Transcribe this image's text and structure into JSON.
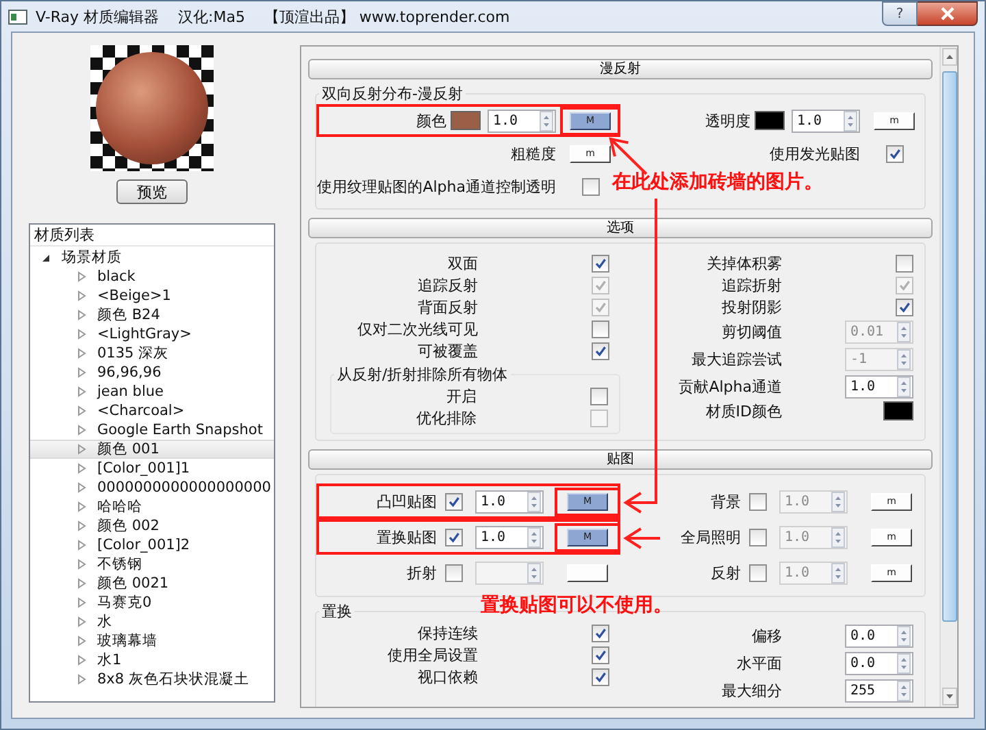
{
  "window": {
    "title": [
      "V-Ray 材质编辑器",
      "汉化:Ma5",
      "【顶渲出品】 www.toprender.com"
    ],
    "help": "?"
  },
  "preview": {
    "button": "预览"
  },
  "material_list": {
    "title": "材质列表",
    "root": {
      "label": "场景材质",
      "expanded": true,
      "children": [
        {
          "label": "black",
          "expanded": false,
          "selected": false
        },
        {
          "label": "<Beige>1",
          "expanded": false,
          "selected": false
        },
        {
          "label": "颜色 B24",
          "expanded": false,
          "selected": false
        },
        {
          "label": "<LightGray>",
          "expanded": false,
          "selected": false
        },
        {
          "label": "0135 深灰",
          "expanded": false,
          "selected": false
        },
        {
          "label": "96,96,96",
          "expanded": false,
          "selected": false
        },
        {
          "label": "jean blue",
          "expanded": false,
          "selected": false
        },
        {
          "label": "<Charcoal>",
          "expanded": false,
          "selected": false
        },
        {
          "label": "Google Earth Snapshot",
          "expanded": false,
          "selected": false
        },
        {
          "label": "颜色 001",
          "expanded": false,
          "selected": true
        },
        {
          "label": "[Color_001]1",
          "expanded": false,
          "selected": false
        },
        {
          "label": "0000000000000000000",
          "expanded": false,
          "selected": false
        },
        {
          "label": "哈哈哈",
          "expanded": false,
          "selected": false
        },
        {
          "label": "颜色 002",
          "expanded": false,
          "selected": false
        },
        {
          "label": "[Color_001]2",
          "expanded": false,
          "selected": false
        },
        {
          "label": "不锈钢",
          "expanded": false,
          "selected": false
        },
        {
          "label": "颜色 0021",
          "expanded": false,
          "selected": false
        },
        {
          "label": "马赛克0",
          "expanded": false,
          "selected": false
        },
        {
          "label": "水",
          "expanded": false,
          "selected": false
        },
        {
          "label": "玻璃幕墙",
          "expanded": false,
          "selected": false
        },
        {
          "label": "水1",
          "expanded": false,
          "selected": false
        },
        {
          "label": "8x8 灰色石块状混凝土",
          "expanded": false,
          "selected": false
        }
      ]
    }
  },
  "sections": [
    {
      "header": "漫反射",
      "groups": [
        {
          "kind": "diffuse",
          "title": "双向反射分布-漫反射",
          "columns": [
            [
              {
                "kind": "field",
                "label": "颜色",
                "highlighted": true,
                "controls": [
                  {
                    "kind": "swatch",
                    "color": "#9b5f48"
                  },
                  {
                    "kind": "spin",
                    "value": "1.0",
                    "disabled": false
                  },
                  {
                    "kind": "map",
                    "text": "M",
                    "assigned": true,
                    "highlighted": true
                  }
                ]
              },
              {
                "kind": "field",
                "label": "粗糙度",
                "highlighted": false,
                "controls": [
                  {
                    "kind": "map",
                    "text": "m",
                    "assigned": false,
                    "highlighted": false
                  }
                ]
              },
              {
                "kind": "field",
                "label": "使用纹理贴图的Alpha通道控制透明",
                "highlighted": false,
                "controls": [
                  {
                    "kind": "check",
                    "checked": false,
                    "disabled": false
                  }
                ]
              }
            ],
            [
              {
                "kind": "field",
                "label": "透明度",
                "highlighted": false,
                "controls": [
                  {
                    "kind": "swatch",
                    "color": "#000000"
                  },
                  {
                    "kind": "spin",
                    "value": "1.0",
                    "disabled": false
                  },
                  {
                    "kind": "map",
                    "text": "m",
                    "assigned": false,
                    "highlighted": false
                  }
                ]
              },
              {
                "kind": "field",
                "label": "使用发光贴图",
                "highlighted": false,
                "controls": [
                  {
                    "kind": "check",
                    "checked": true,
                    "disabled": false
                  }
                ]
              }
            ]
          ]
        }
      ]
    },
    {
      "header": "选项",
      "groups": [
        {
          "kind": "opts",
          "columns": [
            [
              {
                "kind": "field",
                "label": "双面",
                "controls": [
                  {
                    "kind": "check",
                    "checked": true,
                    "disabled": false
                  }
                ]
              },
              {
                "kind": "field",
                "label": "追踪反射",
                "controls": [
                  {
                    "kind": "check",
                    "checked": true,
                    "disabled": true
                  }
                ]
              },
              {
                "kind": "field",
                "label": "背面反射",
                "controls": [
                  {
                    "kind": "check",
                    "checked": true,
                    "disabled": true
                  }
                ]
              },
              {
                "kind": "field",
                "label": "仅对二次光线可见",
                "controls": [
                  {
                    "kind": "check",
                    "checked": false,
                    "disabled": false
                  }
                ]
              },
              {
                "kind": "field",
                "label": "可被覆盖",
                "controls": [
                  {
                    "kind": "check",
                    "checked": true,
                    "disabled": false
                  }
                ]
              },
              {
                "kind": "subgroup",
                "title": "从反射/折射排除所有物体",
                "fields": [
                  {
                    "kind": "field",
                    "label": "开启",
                    "controls": [
                      {
                        "kind": "check",
                        "checked": false,
                        "disabled": false
                      }
                    ]
                  },
                  {
                    "kind": "field",
                    "label": "优化排除",
                    "controls": [
                      {
                        "kind": "check",
                        "checked": false,
                        "disabled": true
                      }
                    ]
                  }
                ]
              }
            ],
            [
              {
                "kind": "field",
                "label": "关掉体积雾",
                "controls": [
                  {
                    "kind": "check",
                    "checked": false,
                    "disabled": false
                  }
                ]
              },
              {
                "kind": "field",
                "label": "追踪折射",
                "controls": [
                  {
                    "kind": "check",
                    "checked": true,
                    "disabled": true
                  }
                ]
              },
              {
                "kind": "field",
                "label": "投射阴影",
                "controls": [
                  {
                    "kind": "check",
                    "checked": true,
                    "disabled": false
                  }
                ]
              },
              {
                "kind": "field",
                "label": "剪切阈值",
                "controls": [
                  {
                    "kind": "spin",
                    "value": "0.01",
                    "disabled": true
                  }
                ]
              },
              {
                "kind": "field",
                "label": "最大追踪尝试",
                "controls": [
                  {
                    "kind": "spin",
                    "value": "-1",
                    "disabled": true
                  }
                ]
              },
              {
                "kind": "field",
                "label": "贡献Alpha通道",
                "controls": [
                  {
                    "kind": "spin",
                    "value": "1.0",
                    "disabled": false
                  }
                ]
              },
              {
                "kind": "field",
                "label": "材质ID颜色",
                "controls": [
                  {
                    "kind": "swatch",
                    "color": "#000000"
                  }
                ]
              }
            ]
          ]
        }
      ]
    },
    {
      "header": "贴图",
      "groups": [
        {
          "kind": "maps",
          "columns": [
            [
              {
                "kind": "field",
                "label": "凸凹贴图",
                "highlighted": true,
                "controls": [
                  {
                    "kind": "check",
                    "checked": true,
                    "disabled": false
                  },
                  {
                    "kind": "spin",
                    "value": "1.0",
                    "disabled": false
                  },
                  {
                    "kind": "map",
                    "text": "M",
                    "assigned": true,
                    "highlighted": true
                  }
                ]
              },
              {
                "kind": "field",
                "label": "置换贴图",
                "highlighted": true,
                "controls": [
                  {
                    "kind": "check",
                    "checked": true,
                    "disabled": false
                  },
                  {
                    "kind": "spin",
                    "value": "1.0",
                    "disabled": false
                  },
                  {
                    "kind": "map",
                    "text": "M",
                    "assigned": true,
                    "highlighted": true
                  }
                ]
              },
              {
                "kind": "field",
                "label": "折射",
                "highlighted": false,
                "controls": [
                  {
                    "kind": "check",
                    "checked": false,
                    "disabled": false
                  },
                  {
                    "kind": "spin",
                    "disabled": true
                  },
                  {
                    "kind": "map",
                    "assigned": false,
                    "highlighted": false
                  }
                ]
              }
            ],
            [
              {
                "kind": "field",
                "label": "背景",
                "highlighted": false,
                "controls": [
                  {
                    "kind": "check",
                    "checked": false,
                    "disabled": false
                  },
                  {
                    "kind": "spin",
                    "value": "1.0",
                    "disabled": true
                  },
                  {
                    "kind": "map",
                    "text": "m",
                    "assigned": false,
                    "highlighted": false
                  }
                ]
              },
              {
                "kind": "field",
                "label": "全局照明",
                "highlighted": false,
                "controls": [
                  {
                    "kind": "check",
                    "checked": false,
                    "disabled": false
                  },
                  {
                    "kind": "spin",
                    "value": "1.0",
                    "disabled": true
                  },
                  {
                    "kind": "map",
                    "text": "m",
                    "assigned": false,
                    "highlighted": false
                  }
                ]
              },
              {
                "kind": "field",
                "label": "反射",
                "highlighted": false,
                "controls": [
                  {
                    "kind": "check",
                    "checked": false,
                    "disabled": false
                  },
                  {
                    "kind": "spin",
                    "value": "1.0",
                    "disabled": true
                  },
                  {
                    "kind": "map",
                    "text": "m",
                    "assigned": false,
                    "highlighted": false
                  }
                ]
              }
            ]
          ]
        },
        {
          "kind": "opts",
          "title": "置换",
          "columns": [
            [
              {
                "kind": "field",
                "label": "保持连续",
                "controls": [
                  {
                    "kind": "check",
                    "checked": true,
                    "disabled": false
                  }
                ]
              },
              {
                "kind": "field",
                "label": "使用全局设置",
                "controls": [
                  {
                    "kind": "check",
                    "checked": true,
                    "disabled": false
                  }
                ]
              },
              {
                "kind": "field",
                "label": "视口依赖",
                "controls": [
                  {
                    "kind": "check",
                    "checked": true,
                    "disabled": false
                  }
                ]
              }
            ],
            [
              {
                "kind": "field",
                "label": "偏移",
                "controls": [
                  {
                    "kind": "spin",
                    "value": "0.0",
                    "disabled": false
                  }
                ]
              },
              {
                "kind": "field",
                "label": "水平面",
                "controls": [
                  {
                    "kind": "spin",
                    "value": "0.0",
                    "disabled": false
                  }
                ]
              },
              {
                "kind": "field",
                "label": "最大细分",
                "controls": [
                  {
                    "kind": "spin",
                    "value": "255",
                    "disabled": false
                  }
                ]
              }
            ]
          ]
        }
      ]
    }
  ],
  "notes": [
    "在此处添加砖墙的图片。",
    "置换贴图可以不使用。"
  ]
}
